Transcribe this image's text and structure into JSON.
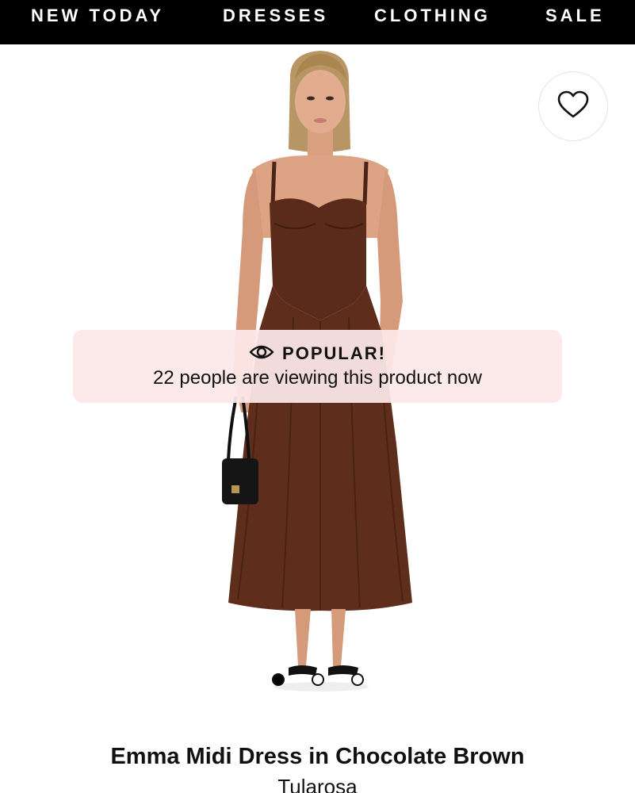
{
  "nav": {
    "items": [
      {
        "label": "NEW TODAY"
      },
      {
        "label": "DRESSES"
      },
      {
        "label": "CLOTHING"
      },
      {
        "label": "SALE"
      }
    ]
  },
  "favorite": {
    "icon": "heart-icon"
  },
  "popular": {
    "icon": "eye-icon",
    "title": "POPULAR!",
    "message": "22 people are viewing this product now"
  },
  "gallery": {
    "image_count": 3,
    "active_index": 0,
    "dress_color": "#5a2a1a"
  },
  "product": {
    "name": "Emma Midi Dress in Chocolate Brown",
    "brand": "Tularosa"
  },
  "colors": {
    "nav_bg": "#000000",
    "banner_bg": "#fce8e8"
  }
}
